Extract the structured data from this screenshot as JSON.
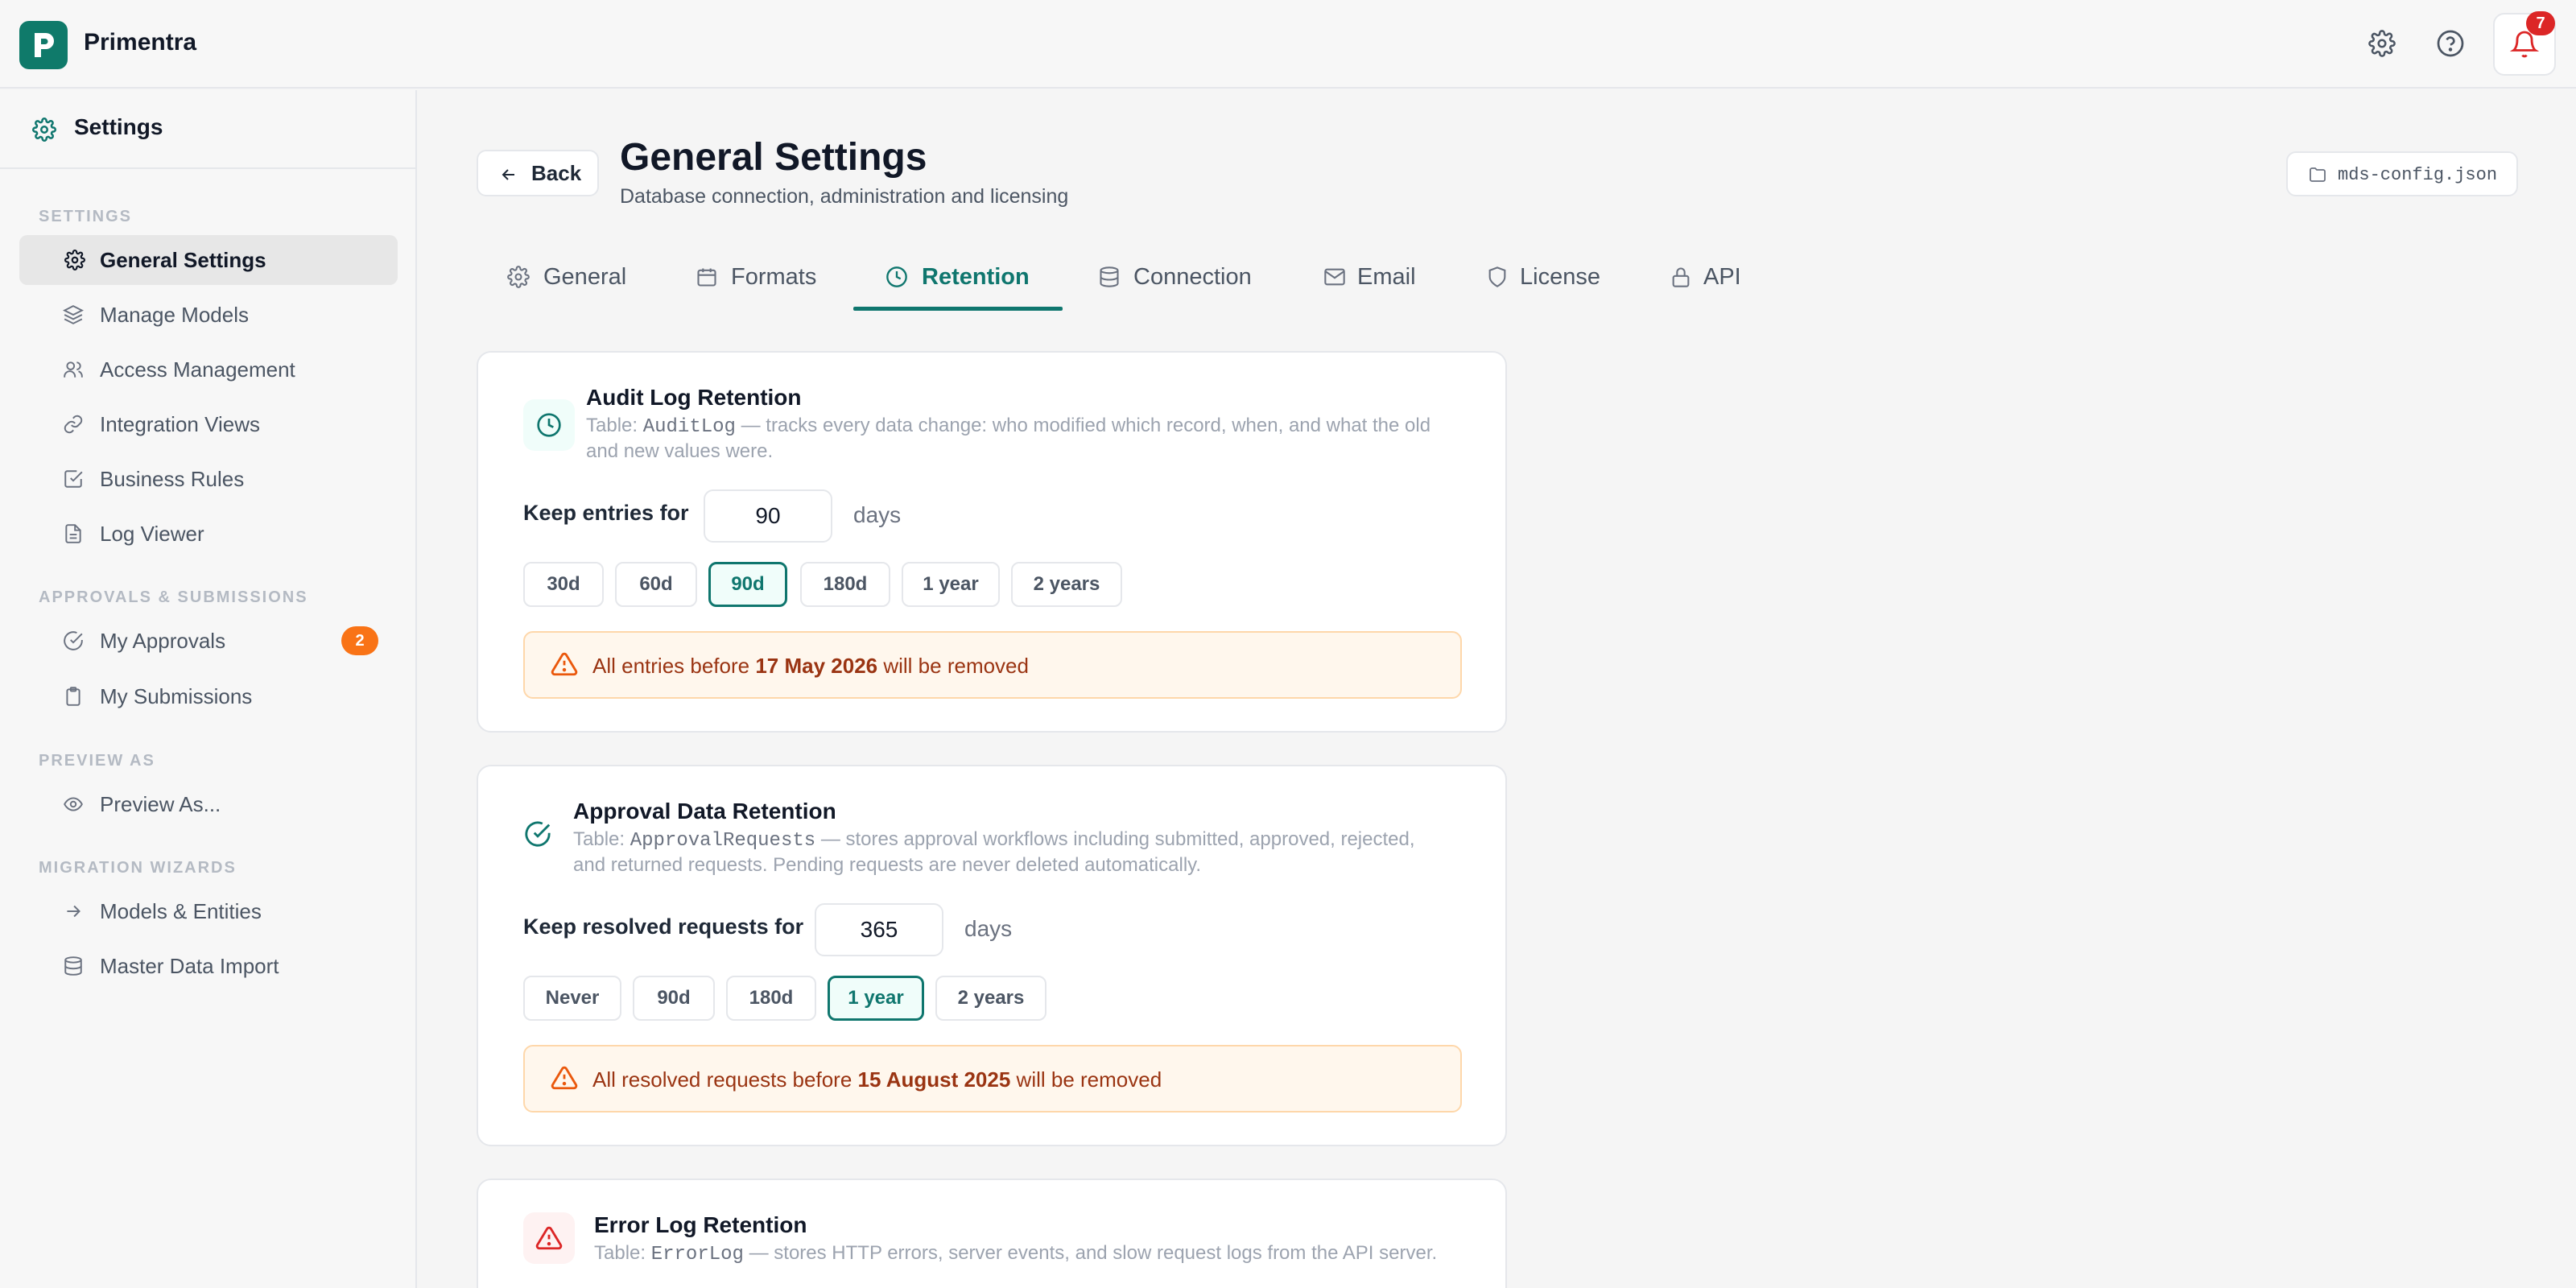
{
  "app": {
    "name": "Primentra",
    "notification_count": "7"
  },
  "sidebar": {
    "title": "Settings",
    "sections": {
      "settings": "SETTINGS",
      "approvals": "APPROVALS & SUBMISSIONS",
      "preview": "PREVIEW AS",
      "migration": "MIGRATION WIZARDS"
    },
    "items": {
      "general_settings": "General Settings",
      "manage_models": "Manage Models",
      "access_management": "Access Management",
      "integration_views": "Integration Views",
      "business_rules": "Business Rules",
      "log_viewer": "Log Viewer",
      "my_approvals": "My Approvals",
      "my_approvals_badge": "2",
      "my_submissions": "My Submissions",
      "preview_as": "Preview As...",
      "models_entities": "Models & Entities",
      "master_data_import": "Master Data Import"
    }
  },
  "header": {
    "back_label": "Back",
    "title": "General Settings",
    "subtitle": "Database connection, administration and licensing",
    "config_file": "mds-config.json"
  },
  "tabs": {
    "general": "General",
    "formats": "Formats",
    "retention": "Retention",
    "connection": "Connection",
    "email": "Email",
    "license": "License",
    "api": "API",
    "active": "Retention"
  },
  "audit": {
    "title": "Audit Log Retention",
    "desc_prefix": "Table: ",
    "table": "AuditLog",
    "desc_line1": " — tracks every data change: who modified which record, when, and what the old",
    "desc_line2": "and new values were.",
    "keep_label": "Keep entries for",
    "value": "90",
    "unit": "days",
    "presets": [
      "30d",
      "60d",
      "90d",
      "180d",
      "1 year",
      "2 years"
    ],
    "selected": "90d",
    "warn_prefix": "All entries before ",
    "warn_date": "17 May 2026",
    "warn_suffix": " will be removed"
  },
  "approval": {
    "title": "Approval Data Retention",
    "desc_prefix": "Table: ",
    "table": "ApprovalRequests",
    "desc_line1": " — stores approval workflows including submitted, approved, rejected,",
    "desc_line2": "and returned requests. Pending requests are never deleted automatically.",
    "keep_label": "Keep resolved requests for",
    "value": "365",
    "unit": "days",
    "presets": [
      "Never",
      "90d",
      "180d",
      "1 year",
      "2 years"
    ],
    "selected": "1 year",
    "warn_prefix": "All resolved requests before ",
    "warn_date": "15 August 2025",
    "warn_suffix": " will be removed"
  },
  "error": {
    "title": "Error Log Retention",
    "desc_prefix": "Table: ",
    "table": "ErrorLog",
    "desc_line1": " — stores HTTP errors, server events, and slow request logs from the API server."
  },
  "colors": {
    "accent": "#0f766e",
    "brand": "#0f7a6a",
    "warning_bg": "#fff7ed",
    "warning_text": "#9a3412",
    "badge_orange": "#f97316",
    "badge_red": "#dc2626"
  }
}
